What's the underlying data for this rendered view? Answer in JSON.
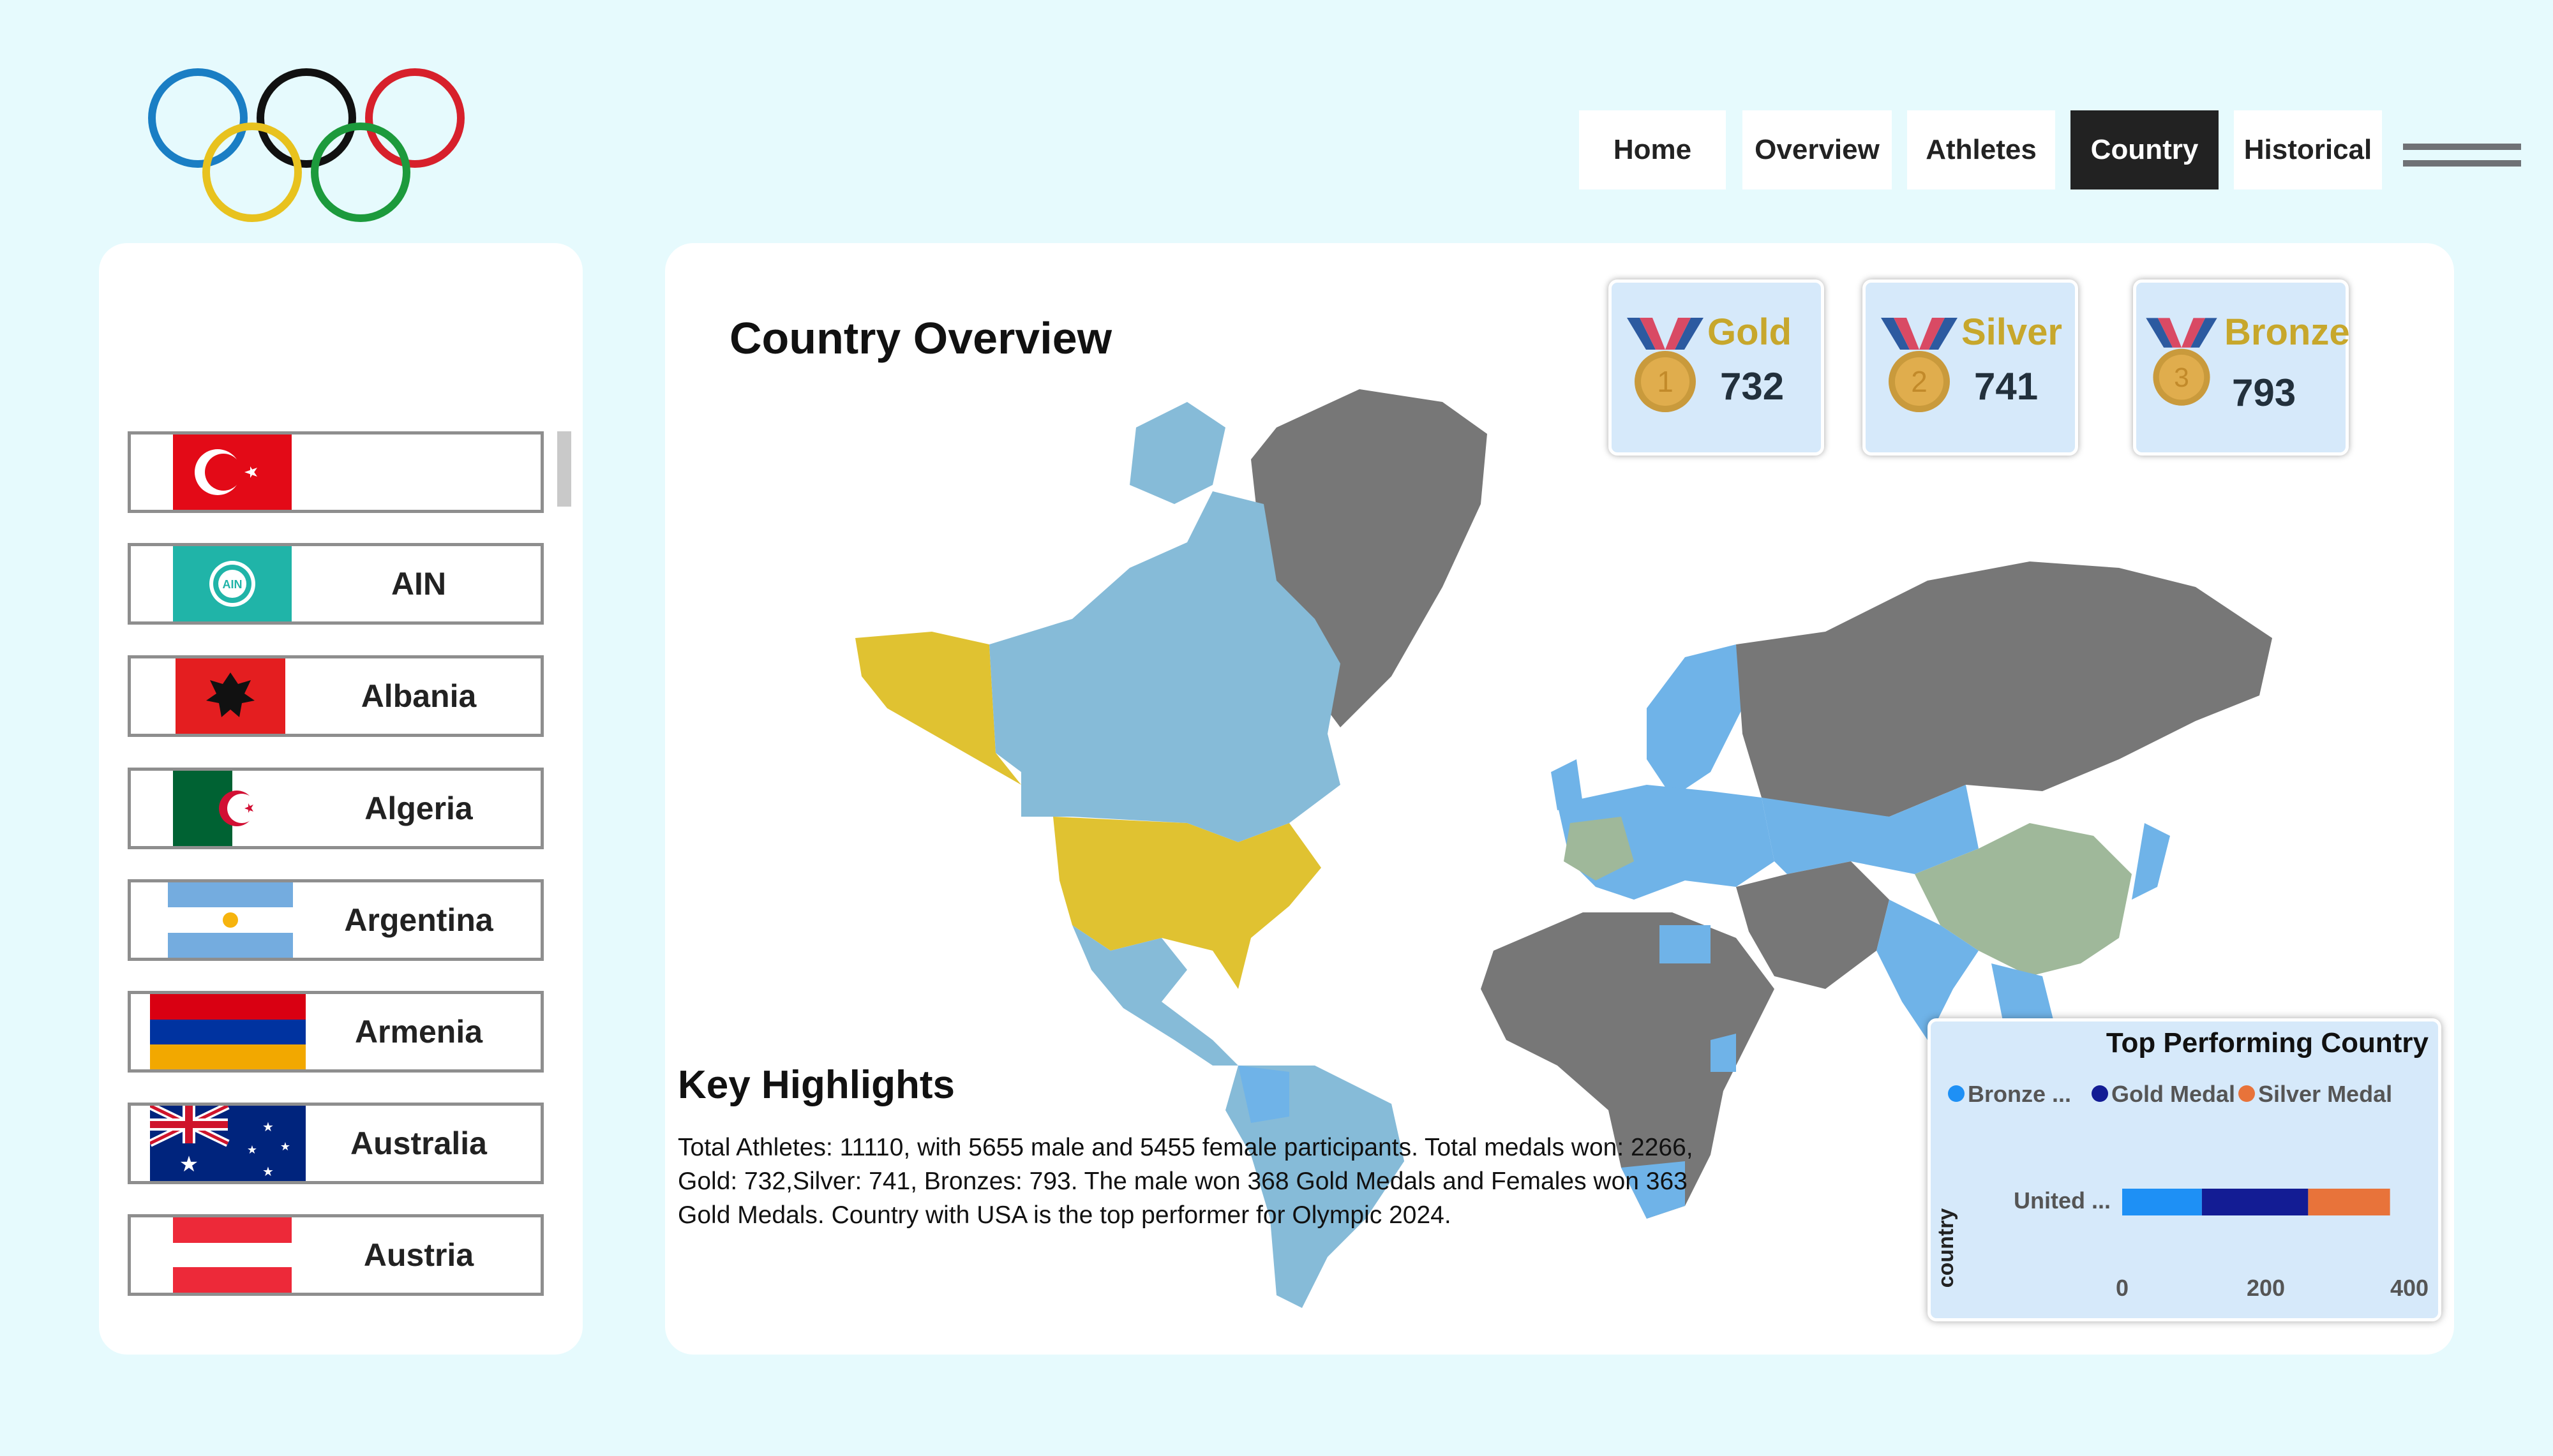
{
  "nav": {
    "home": "Home",
    "overview": "Overview",
    "athletes": "Athletes",
    "country": "Country",
    "historical": "Historical"
  },
  "colors": {
    "gold": "#c7a72c",
    "active_nav": "#222222",
    "map_participant": "#86bbd8",
    "map_gold_leader": "#e0c231",
    "map_second": "#9fb89a",
    "map_other": "#777777"
  },
  "sidebar": {
    "countries": [
      {
        "name": "",
        "flag": "turkey-flag"
      },
      {
        "name": "AIN",
        "flag": "ain-flag"
      },
      {
        "name": "Albania",
        "flag": "albania-flag"
      },
      {
        "name": "Algeria",
        "flag": "algeria-flag"
      },
      {
        "name": "Argentina",
        "flag": "argentina-flag"
      },
      {
        "name": "Armenia",
        "flag": "armenia-flag"
      },
      {
        "name": "Australia",
        "flag": "australia-flag"
      },
      {
        "name": "Austria",
        "flag": "austria-flag"
      }
    ]
  },
  "main": {
    "title": "Country Overview",
    "medals": [
      {
        "label": "Gold",
        "value": "732",
        "number": "1"
      },
      {
        "label": "Silver",
        "value": "741",
        "number": "2"
      },
      {
        "label": "Bronze",
        "value": "793",
        "number": "3"
      }
    ],
    "highlights": {
      "heading": "Key Highlights",
      "text": "Total Athletes: 11110, with 5655 male and 5455 female participants. Total medals won: 2266, Gold: 732,Silver: 741, Bronzes: 793. The male won 368 Gold Medals and Females won 363 Gold Medals. Country with USA is the top performer for Olympic 2024."
    }
  },
  "chart_data": {
    "type": "bar",
    "title": "Top Performing Country",
    "ylabel": "country",
    "categories": [
      "United ..."
    ],
    "series": [
      {
        "name": "Bronze ...",
        "values": [
          111
        ],
        "color": "#1e90f5"
      },
      {
        "name": "Gold Medal",
        "values": [
          148
        ],
        "color": "#131c94"
      },
      {
        "name": "Silver Medal",
        "values": [
          114
        ],
        "color": "#e8733a"
      }
    ],
    "stacked": true,
    "xlim": [
      0,
      400
    ],
    "xticks": [
      "0",
      "200",
      "400"
    ],
    "legend": "top"
  }
}
